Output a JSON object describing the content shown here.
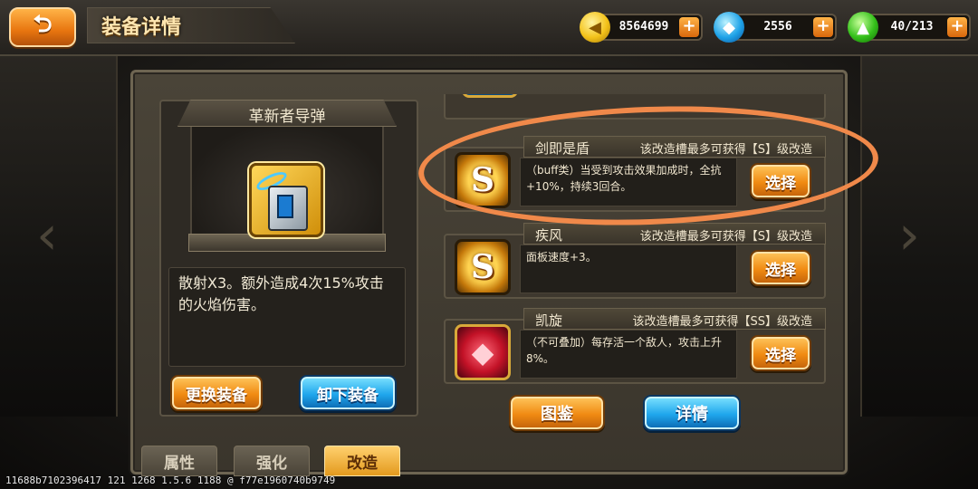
{
  "header": {
    "title": "装备详情",
    "back_label": "⮌",
    "resources": [
      {
        "icon": "gold-coin-icon",
        "value": "8564699",
        "plus": "+"
      },
      {
        "icon": "blue-gem-icon",
        "value": "2556",
        "plus": "+"
      },
      {
        "icon": "energy-icon",
        "value": "40/213",
        "plus": "+"
      }
    ]
  },
  "equipment": {
    "name": "革新者导弹",
    "description": "散射X3。额外造成4次15%攻击的火焰伤害。",
    "change_label": "更换装备",
    "unequip_label": "卸下装备"
  },
  "mods": [
    {
      "name": "剑即是盾",
      "cap": "该改造槽最多可获得【S】级改造",
      "desc": "（buff类）当受到攻击效果加成时，全抗+10%，持续3回合。",
      "icon_letter": "S",
      "select_label": "选择"
    },
    {
      "name": "疾风",
      "cap": "该改造槽最多可获得【S】级改造",
      "desc": "面板速度+3。",
      "icon_letter": "S",
      "select_label": "选择"
    },
    {
      "name": "凯旋",
      "cap": "该改造槽最多可获得【SS】级改造",
      "desc": "（不可叠加）每存活一个敌人，攻击上升8%。",
      "icon_letter": "◆",
      "select_label": "选择"
    }
  ],
  "actions": {
    "codex_label": "图鉴",
    "detail_label": "详情"
  },
  "tabs": [
    {
      "label": "属性",
      "active": false
    },
    {
      "label": "强化",
      "active": false
    },
    {
      "label": "改造",
      "active": true
    }
  ],
  "watermark": "11688b7102396417 121 1268 1.5.6 1188 @ f77e1960740b9749",
  "colors": {
    "accent_orange": "#f08a12",
    "accent_blue": "#1fa6ec",
    "highlight_ring": "#f0894a"
  }
}
